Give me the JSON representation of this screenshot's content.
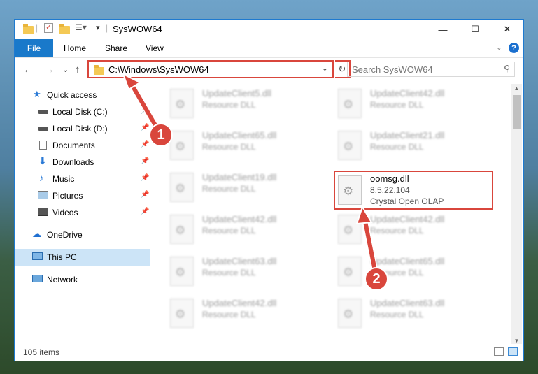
{
  "window": {
    "title": "SysWOW64",
    "controls": {
      "minimize": "—",
      "maximize": "☐",
      "close": "✕"
    }
  },
  "ribbon": {
    "tabs": [
      "File",
      "Home",
      "Share",
      "View"
    ],
    "help": "?"
  },
  "navigation": {
    "back": "←",
    "forward": "→",
    "recent": "⌄",
    "up": "↑",
    "address": "C:\\Windows\\SysWOW64",
    "refresh": "↻",
    "search_placeholder": "Search SysWOW64"
  },
  "sidebar": {
    "items": [
      {
        "label": "Quick access",
        "icon": "star-icon",
        "pinned": false
      },
      {
        "label": "Local Disk (C:)",
        "icon": "drive-icon",
        "pinned": true
      },
      {
        "label": "Local Disk (D:)",
        "icon": "drive-icon",
        "pinned": true
      },
      {
        "label": "Documents",
        "icon": "documents-icon",
        "pinned": true
      },
      {
        "label": "Downloads",
        "icon": "download-icon",
        "pinned": true
      },
      {
        "label": "Music",
        "icon": "music-icon",
        "pinned": true
      },
      {
        "label": "Pictures",
        "icon": "pictures-icon",
        "pinned": true
      },
      {
        "label": "Videos",
        "icon": "videos-icon",
        "pinned": true
      },
      {
        "label": "OneDrive",
        "icon": "cloud-icon",
        "pinned": false
      },
      {
        "label": "This PC",
        "icon": "computer-icon",
        "pinned": false,
        "selected": true
      },
      {
        "label": "Network",
        "icon": "network-icon",
        "pinned": false
      }
    ]
  },
  "files": [
    {
      "name": "UpdateClient5.dll",
      "type": "Resource DLL"
    },
    {
      "name": "UpdateClient42.dll",
      "type": "Resource DLL"
    },
    {
      "name": "UpdateClient65.dll",
      "type": "Resource DLL"
    },
    {
      "name": "UpdateClient21.dll",
      "type": "Resource DLL"
    },
    {
      "name": "UpdateClient19.dll",
      "type": "Resource DLL"
    },
    {
      "name": "oomsg.dll",
      "version": "8.5.22.104",
      "type": "Crystal Open OLAP"
    },
    {
      "name": "UpdateClient42.dll",
      "type": "Resource DLL"
    },
    {
      "name": "UpdateClient42.dll",
      "type": "Resource DLL"
    },
    {
      "name": "UpdateClient63.dll",
      "type": "Resource DLL"
    },
    {
      "name": "UpdateClient65.dll",
      "type": "Resource DLL"
    },
    {
      "name": "UpdateClient42.dll",
      "type": "Resource DLL"
    },
    {
      "name": "UpdateClient63.dll",
      "type": "Resource DLL"
    }
  ],
  "status": {
    "item_count": "105 items"
  },
  "annotations": {
    "callout_1": "1",
    "callout_2": "2",
    "accent_color": "#d9463c"
  }
}
